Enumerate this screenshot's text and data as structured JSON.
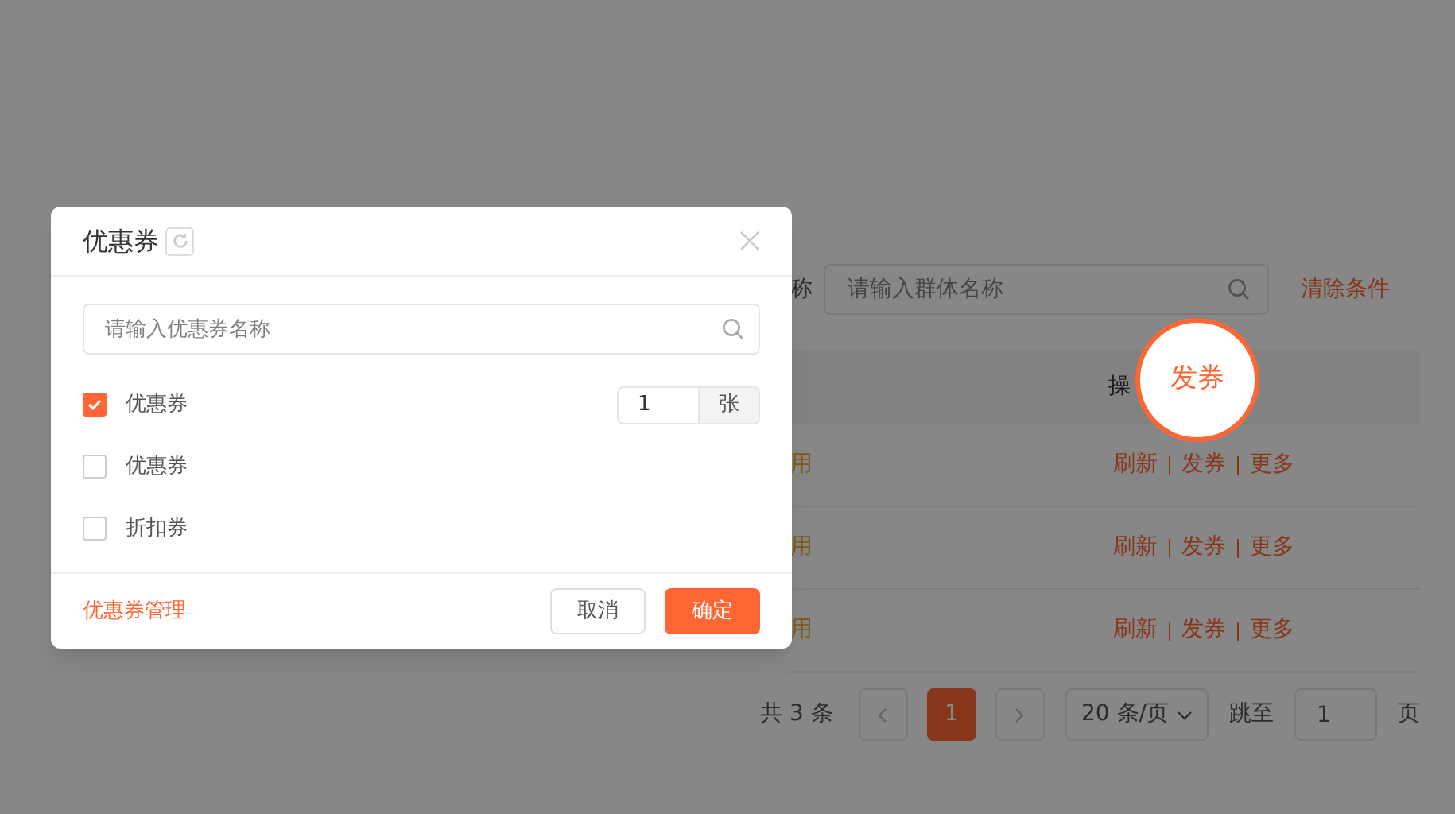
{
  "background": {
    "filter": {
      "label": "称",
      "placeholder": "请输入群体名称",
      "clear_link": "清除条件"
    },
    "table": {
      "header": "操",
      "rows": [
        {
          "status": "用",
          "actions": [
            "刷新",
            "发券",
            "更多"
          ]
        },
        {
          "status": "用",
          "actions": [
            "刷新",
            "发券",
            "更多"
          ]
        },
        {
          "status": "用",
          "actions": [
            "刷新",
            "发券",
            "更多"
          ]
        }
      ]
    },
    "pagination": {
      "total": "共 3 条",
      "pages": [
        {
          "label": "1",
          "selected": true
        }
      ],
      "page_size": "20 条/页",
      "jump_label": "跳至",
      "jump_value": "1",
      "page_suffix": "页"
    }
  },
  "modal": {
    "title": "优惠券",
    "search_placeholder": "请输入优惠券名称",
    "items": [
      {
        "label": "优惠券",
        "checked": true,
        "quantity": "1",
        "unit": "张"
      },
      {
        "label": "优惠券",
        "checked": false
      },
      {
        "label": "折扣券",
        "checked": false
      }
    ],
    "manage_link": "优惠券管理",
    "cancel": "取消",
    "confirm": "确定"
  },
  "tooltip": {
    "text": "发券"
  }
}
